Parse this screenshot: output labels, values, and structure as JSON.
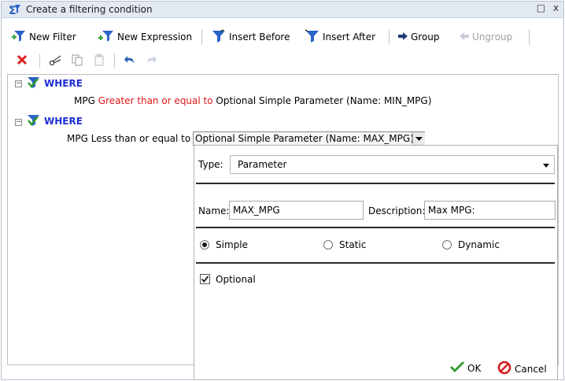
{
  "window": {
    "title": "Create a filtering condition",
    "restore_glyph": "□",
    "close_glyph": "x"
  },
  "toolbar1": {
    "new_filter": "New Filter",
    "new_expression": "New Expression",
    "insert_before": "Insert Before",
    "insert_after": "Insert After",
    "group": "Group",
    "ungroup": "Ungroup"
  },
  "tree": {
    "where1": "WHERE",
    "cond1_field": "MPG",
    "cond1_operator": "Greater than or equal to",
    "cond1_value": "Optional Simple Parameter (Name: MIN_MPG)",
    "where2": "WHERE",
    "cond2_field": "MPG",
    "cond2_operator": "Less than or equal to",
    "cond2_value": "Optional Simple Parameter (Name: MAX_MPG)"
  },
  "panel": {
    "type_label": "Type:",
    "type_value": "Parameter",
    "name_label": "Name:",
    "name_value": "MAX_MPG",
    "description_label": "Description:",
    "description_value": "Max MPG:",
    "radio_simple": "Simple",
    "radio_static": "Static",
    "radio_dynamic": "Dynamic",
    "selected_radio": "Simple",
    "optional_label": "Optional",
    "optional_checked": true
  },
  "footer": {
    "ok": "OK",
    "cancel": "Cancel"
  },
  "colors": {
    "keyword": "#1f2fd6",
    "operator_red": "#e01717",
    "titlebar": "#e3e9f1"
  }
}
